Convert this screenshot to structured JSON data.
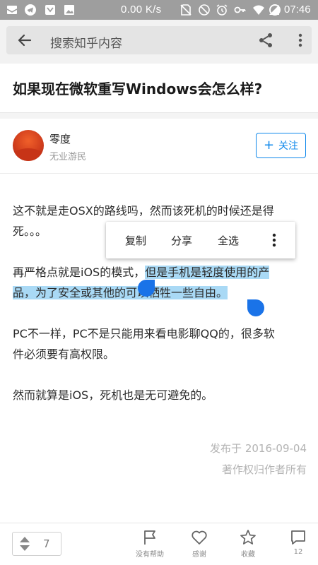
{
  "status_bar": {
    "net_speed": "0.00 K/s",
    "time": "07:46",
    "left_icons": [
      "mail-icon",
      "telegram-icon",
      "store-icon",
      "image-icon"
    ],
    "right_icons": [
      "no-sim-icon",
      "alarm-icon",
      "key-icon",
      "wifi-icon",
      "signal-icon",
      "battery-icon"
    ]
  },
  "app_bar": {
    "search_placeholder": "搜索知乎内容",
    "icons": [
      "back-arrow-icon",
      "share-icon",
      "more-vertical-icon"
    ]
  },
  "question": {
    "title": "如果现在微软重写Windows会怎么样?"
  },
  "author": {
    "name": "零度",
    "bio": "无业游民",
    "follow_label": "关注"
  },
  "content": {
    "p1_line1": "这不就是走OSX的路线吗，然而该死机的时候还是得",
    "p1_line2": "死。。。",
    "p2_line1_plain": "再严格点就是iOS的模式，",
    "p2_line1_selected": "但是手机是轻度使用的产",
    "p2_line2_selected": "品，为了安全或其他的可以牺牲一些自由。",
    "p3_line1": "PC不一样，PC不是只能用来看电影聊QQ的，很多软",
    "p3_line2": "件必须要有高权限。",
    "p4_line1": "然而就算是iOS，死机也是无可避免的。"
  },
  "context_menu": {
    "copy": "复制",
    "share": "分享",
    "select_all": "全选"
  },
  "meta": {
    "published": "发布于 2016-09-04",
    "copyright": "著作权归作者所有"
  },
  "bottom_bar": {
    "vote_count": "7",
    "unhelpful": "没有帮助",
    "thanks": "感谢",
    "collect": "收藏",
    "comments": "12"
  },
  "colors": {
    "accent": "#0f88eb",
    "selection": "#a9d9f5",
    "handle": "#1a73e8",
    "status_bar": "#9e9e9e"
  }
}
